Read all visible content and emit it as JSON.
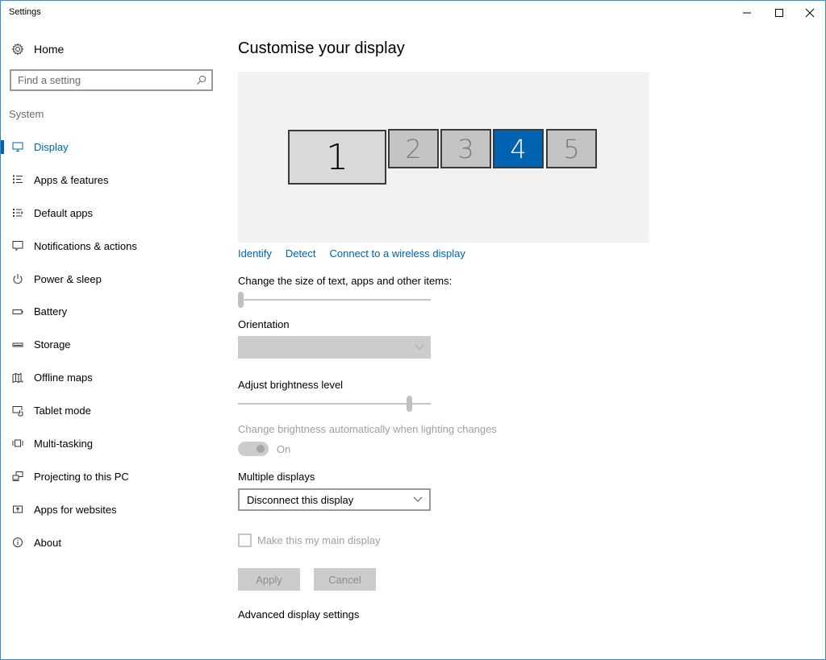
{
  "window": {
    "title": "Settings",
    "controls": {
      "minimize": "minimize-icon",
      "maximize": "maximize-icon",
      "close": "close-icon"
    },
    "border_color": "#3c8bc9"
  },
  "sidebar": {
    "home_label": "Home",
    "home_icon": "gear-icon",
    "search": {
      "placeholder": "Find a setting",
      "value": "",
      "icon": "search-icon"
    },
    "section_label": "System",
    "accent": "#0063b1",
    "items": [
      {
        "label": "Display",
        "icon": "monitor-icon",
        "active": true
      },
      {
        "label": "Apps & features",
        "icon": "list-icon",
        "active": false
      },
      {
        "label": "Default apps",
        "icon": "default-apps-icon",
        "active": false
      },
      {
        "label": "Notifications & actions",
        "icon": "speech-bubble-icon",
        "active": false
      },
      {
        "label": "Power & sleep",
        "icon": "power-icon",
        "active": false
      },
      {
        "label": "Battery",
        "icon": "battery-icon",
        "active": false
      },
      {
        "label": "Storage",
        "icon": "storage-icon",
        "active": false
      },
      {
        "label": "Offline maps",
        "icon": "map-icon",
        "active": false
      },
      {
        "label": "Tablet mode",
        "icon": "tablet-mode-icon",
        "active": false
      },
      {
        "label": "Multi-tasking",
        "icon": "multitasking-icon",
        "active": false
      },
      {
        "label": "Projecting to this PC",
        "icon": "projecting-icon",
        "active": false
      },
      {
        "label": "Apps for websites",
        "icon": "apps-for-websites-icon",
        "active": false
      },
      {
        "label": "About",
        "icon": "info-icon",
        "active": false
      }
    ]
  },
  "main": {
    "title": "Customise your display",
    "monitors": [
      {
        "number": "1",
        "selected": false
      },
      {
        "number": "2",
        "selected": false
      },
      {
        "number": "3",
        "selected": false
      },
      {
        "number": "4",
        "selected": true
      },
      {
        "number": "5",
        "selected": false
      }
    ],
    "links": {
      "identify": "Identify",
      "detect": "Detect",
      "wireless": "Connect to a wireless display"
    },
    "scale": {
      "label": "Change the size of text, apps and other items:",
      "value_fraction": 0.0
    },
    "orientation": {
      "label": "Orientation",
      "value": "",
      "disabled": true
    },
    "brightness": {
      "label": "Adjust brightness level",
      "value_fraction": 0.9
    },
    "auto_brightness": {
      "label": "Change brightness automatically when lighting changes",
      "state": "On",
      "disabled": true
    },
    "multiple_displays": {
      "label": "Multiple displays",
      "value": "Disconnect this display"
    },
    "main_display": {
      "label": "Make this my main display",
      "checked": false,
      "disabled": true
    },
    "buttons": {
      "apply": "Apply",
      "cancel": "Cancel"
    },
    "advanced_link": "Advanced display settings"
  }
}
